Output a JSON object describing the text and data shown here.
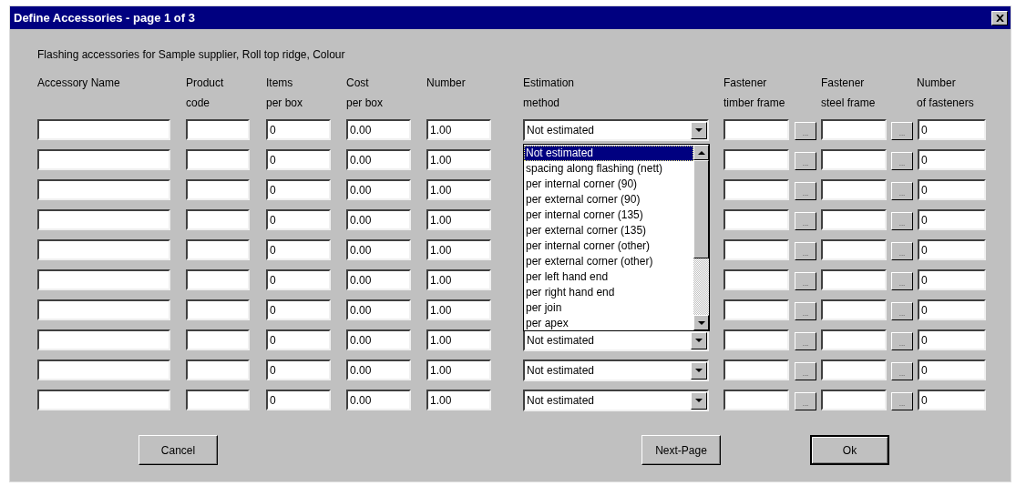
{
  "window": {
    "title": "Define Accessories - page 1 of 3"
  },
  "subtitle": "Flashing accessories for Sample supplier, Roll top ridge, Colour",
  "columns": [
    "Accessory Name",
    "Product\ncode",
    "Items\nper box",
    "Cost\nper box",
    "Number",
    "Estimation\nmethod",
    "Fastener\ntimber frame",
    "Fastener\nsteel frame",
    "Number\nof fasteners"
  ],
  "rows": [
    {
      "items_per_box": "0",
      "cost_per_box": "0.00",
      "number": "1.00",
      "estimation_method": "Not estimated",
      "timber_button": "...",
      "steel_button": "...",
      "number_of_fasteners": "0"
    },
    {
      "items_per_box": "0",
      "cost_per_box": "0.00",
      "number": "1.00",
      "timber_button": "...",
      "steel_button": "...",
      "number_of_fasteners": "0"
    },
    {
      "items_per_box": "0",
      "cost_per_box": "0.00",
      "number": "1.00",
      "timber_button": "...",
      "steel_button": "...",
      "number_of_fasteners": "0"
    },
    {
      "items_per_box": "0",
      "cost_per_box": "0.00",
      "number": "1.00",
      "timber_button": "...",
      "steel_button": "...",
      "number_of_fasteners": "0"
    },
    {
      "items_per_box": "0",
      "cost_per_box": "0.00",
      "number": "1.00",
      "timber_button": "...",
      "steel_button": "...",
      "number_of_fasteners": "0"
    },
    {
      "items_per_box": "0",
      "cost_per_box": "0.00",
      "number": "1.00",
      "timber_button": "...",
      "steel_button": "...",
      "number_of_fasteners": "0"
    },
    {
      "items_per_box": "0",
      "cost_per_box": "0.00",
      "number": "1.00",
      "timber_button": "...",
      "steel_button": "...",
      "number_of_fasteners": "0"
    },
    {
      "items_per_box": "0",
      "cost_per_box": "0.00",
      "number": "1.00",
      "estimation_method": "Not estimated",
      "timber_button": "...",
      "steel_button": "...",
      "number_of_fasteners": "0"
    },
    {
      "items_per_box": "0",
      "cost_per_box": "0.00",
      "number": "1.00",
      "estimation_method": "Not estimated",
      "timber_button": "...",
      "steel_button": "...",
      "number_of_fasteners": "0"
    },
    {
      "items_per_box": "0",
      "cost_per_box": "0.00",
      "number": "1.00",
      "estimation_method": "Not estimated",
      "timber_button": "...",
      "steel_button": "...",
      "number_of_fasteners": "0"
    }
  ],
  "dropdown_list": {
    "items": [
      {
        "label": "Not estimated",
        "selected": true
      },
      {
        "label": "spacing along flashing (nett)",
        "selected": false
      },
      {
        "label": "per internal corner (90)",
        "selected": false
      },
      {
        "label": "per external corner (90)",
        "selected": false
      },
      {
        "label": "per internal corner (135)",
        "selected": false
      },
      {
        "label": "per external corner (135)",
        "selected": false
      },
      {
        "label": "per internal corner (other)",
        "selected": false
      },
      {
        "label": "per external corner (other)",
        "selected": false
      },
      {
        "label": "per left hand end",
        "selected": false
      },
      {
        "label": "per right hand end",
        "selected": false
      },
      {
        "label": "per join",
        "selected": false
      },
      {
        "label": "per apex",
        "selected": false
      }
    ]
  },
  "buttons": [
    {
      "label": "Cancel",
      "default": false
    },
    {
      "label": "Next-Page",
      "default": false
    },
    {
      "label": "Ok",
      "default": true
    }
  ]
}
